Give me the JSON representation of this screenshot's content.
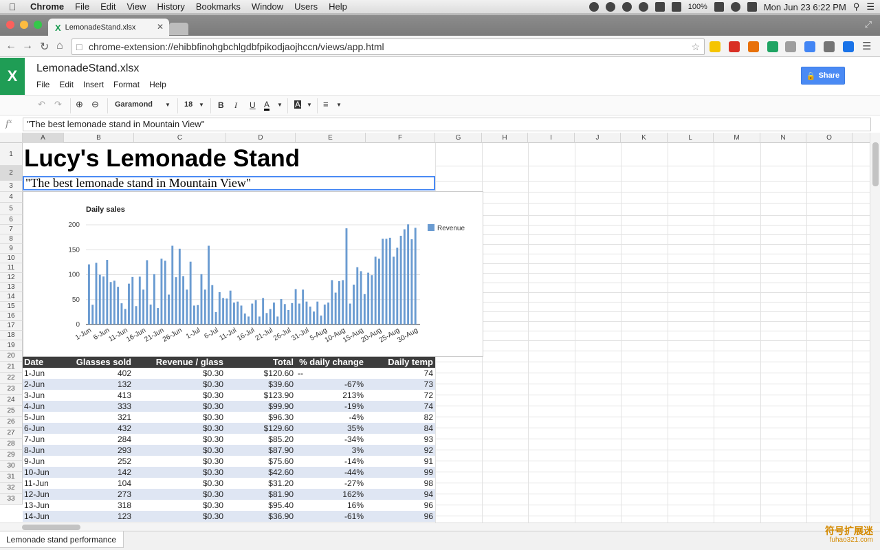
{
  "menubar": {
    "app": "Chrome",
    "items": [
      "File",
      "Edit",
      "View",
      "History",
      "Bookmarks",
      "Window",
      "Users",
      "Help"
    ],
    "battery": "100%",
    "datetime": "Mon Jun 23  6:22 PM"
  },
  "browser": {
    "tab_title": "LemonadeStand.xlsx",
    "url": "chrome-extension://ehibbfinohgbchlgdbfpikodjaojhccn/views/app.html"
  },
  "app": {
    "doc_title": "LemonadeStand.xlsx",
    "menus": [
      "File",
      "Edit",
      "Insert",
      "Format",
      "Help"
    ],
    "share_label": "Share",
    "font_name": "Garamond",
    "font_size": "18",
    "formula_bar": "\"The best lemonade stand in Mountain View\"",
    "fx_label": "f^x"
  },
  "sheet": {
    "columns": [
      "A",
      "B",
      "C",
      "D",
      "E",
      "F",
      "G",
      "H",
      "I",
      "J",
      "K",
      "L",
      "M",
      "N",
      "O"
    ],
    "row_numbers": [
      "1",
      "2",
      "3",
      "4",
      "5",
      "6",
      "7",
      "8",
      "9",
      "10",
      "11",
      "12",
      "13",
      "14",
      "15",
      "16",
      "17",
      "18",
      "19",
      "20",
      "21",
      "22",
      "23",
      "24",
      "25",
      "26",
      "27",
      "28",
      "29",
      "30",
      "31",
      "32",
      "33"
    ],
    "title": "Lucy's Lemonade Stand",
    "subtitle": "\"The best lemonade stand in Mountain View\"",
    "table_headers": [
      "Date",
      "Glasses sold",
      "Revenue / glass",
      "Total",
      "% daily change",
      "Daily temp"
    ],
    "rows": [
      [
        "1-Jun",
        "402",
        "$0.30",
        "$120.60",
        "--",
        "74"
      ],
      [
        "2-Jun",
        "132",
        "$0.30",
        "$39.60",
        "-67%",
        "73"
      ],
      [
        "3-Jun",
        "413",
        "$0.30",
        "$123.90",
        "213%",
        "72"
      ],
      [
        "4-Jun",
        "333",
        "$0.30",
        "$99.90",
        "-19%",
        "74"
      ],
      [
        "5-Jun",
        "321",
        "$0.30",
        "$96.30",
        "-4%",
        "82"
      ],
      [
        "6-Jun",
        "432",
        "$0.30",
        "$129.60",
        "35%",
        "84"
      ],
      [
        "7-Jun",
        "284",
        "$0.30",
        "$85.20",
        "-34%",
        "93"
      ],
      [
        "8-Jun",
        "293",
        "$0.30",
        "$87.90",
        "3%",
        "92"
      ],
      [
        "9-Jun",
        "252",
        "$0.30",
        "$75.60",
        "-14%",
        "91"
      ],
      [
        "10-Jun",
        "142",
        "$0.30",
        "$42.60",
        "-44%",
        "99"
      ],
      [
        "11-Jun",
        "104",
        "$0.30",
        "$31.20",
        "-27%",
        "98"
      ],
      [
        "12-Jun",
        "273",
        "$0.30",
        "$81.90",
        "162%",
        "94"
      ],
      [
        "13-Jun",
        "318",
        "$0.30",
        "$95.40",
        "16%",
        "96"
      ],
      [
        "14-Jun",
        "123",
        "$0.30",
        "$36.90",
        "-61%",
        "96"
      ]
    ],
    "sheet_tab": "Lemonade stand performance"
  },
  "watermark": {
    "line1": "符号扩展迷",
    "line2": "fuhao321.com"
  },
  "chart_data": {
    "type": "bar",
    "title": "Daily sales",
    "legend": [
      "Revenue"
    ],
    "legend_position": "right",
    "color": "#6a9bd1",
    "ylim": [
      0,
      200
    ],
    "yticks": [
      0,
      50,
      100,
      150,
      200
    ],
    "xtick_labels": [
      "1-Jun",
      "6-Jun",
      "11-Jun",
      "16-Jun",
      "21-Jun",
      "26-Jun",
      "1-Jul",
      "6-Jul",
      "11-Jul",
      "16-Jul",
      "21-Jul",
      "26-Jul",
      "31-Jul",
      "5-Aug",
      "10-Aug",
      "15-Aug",
      "20-Aug",
      "25-Aug",
      "30-Aug"
    ],
    "series": [
      {
        "name": "Revenue",
        "values": [
          120.6,
          39.6,
          123.9,
          99.9,
          96.3,
          129.6,
          85.2,
          87.9,
          75.6,
          42.6,
          31.2,
          81.9,
          95.4,
          36.9,
          96,
          70,
          129,
          40,
          101,
          33,
          132,
          128,
          60,
          158,
          95,
          152,
          97,
          70,
          126,
          38,
          39,
          101,
          70,
          158,
          79,
          25,
          65,
          53,
          52,
          68,
          44,
          46,
          38,
          22,
          16,
          42,
          49,
          16,
          53,
          23,
          31,
          44,
          16,
          51,
          41,
          29,
          43,
          71,
          42,
          70,
          46,
          36,
          26,
          46,
          18,
          40,
          44,
          89,
          64,
          87,
          89,
          193,
          42,
          80,
          115,
          107,
          61,
          104,
          99,
          136,
          132,
          172,
          172,
          174,
          136,
          154,
          178,
          191,
          201,
          171,
          194
        ]
      }
    ]
  }
}
